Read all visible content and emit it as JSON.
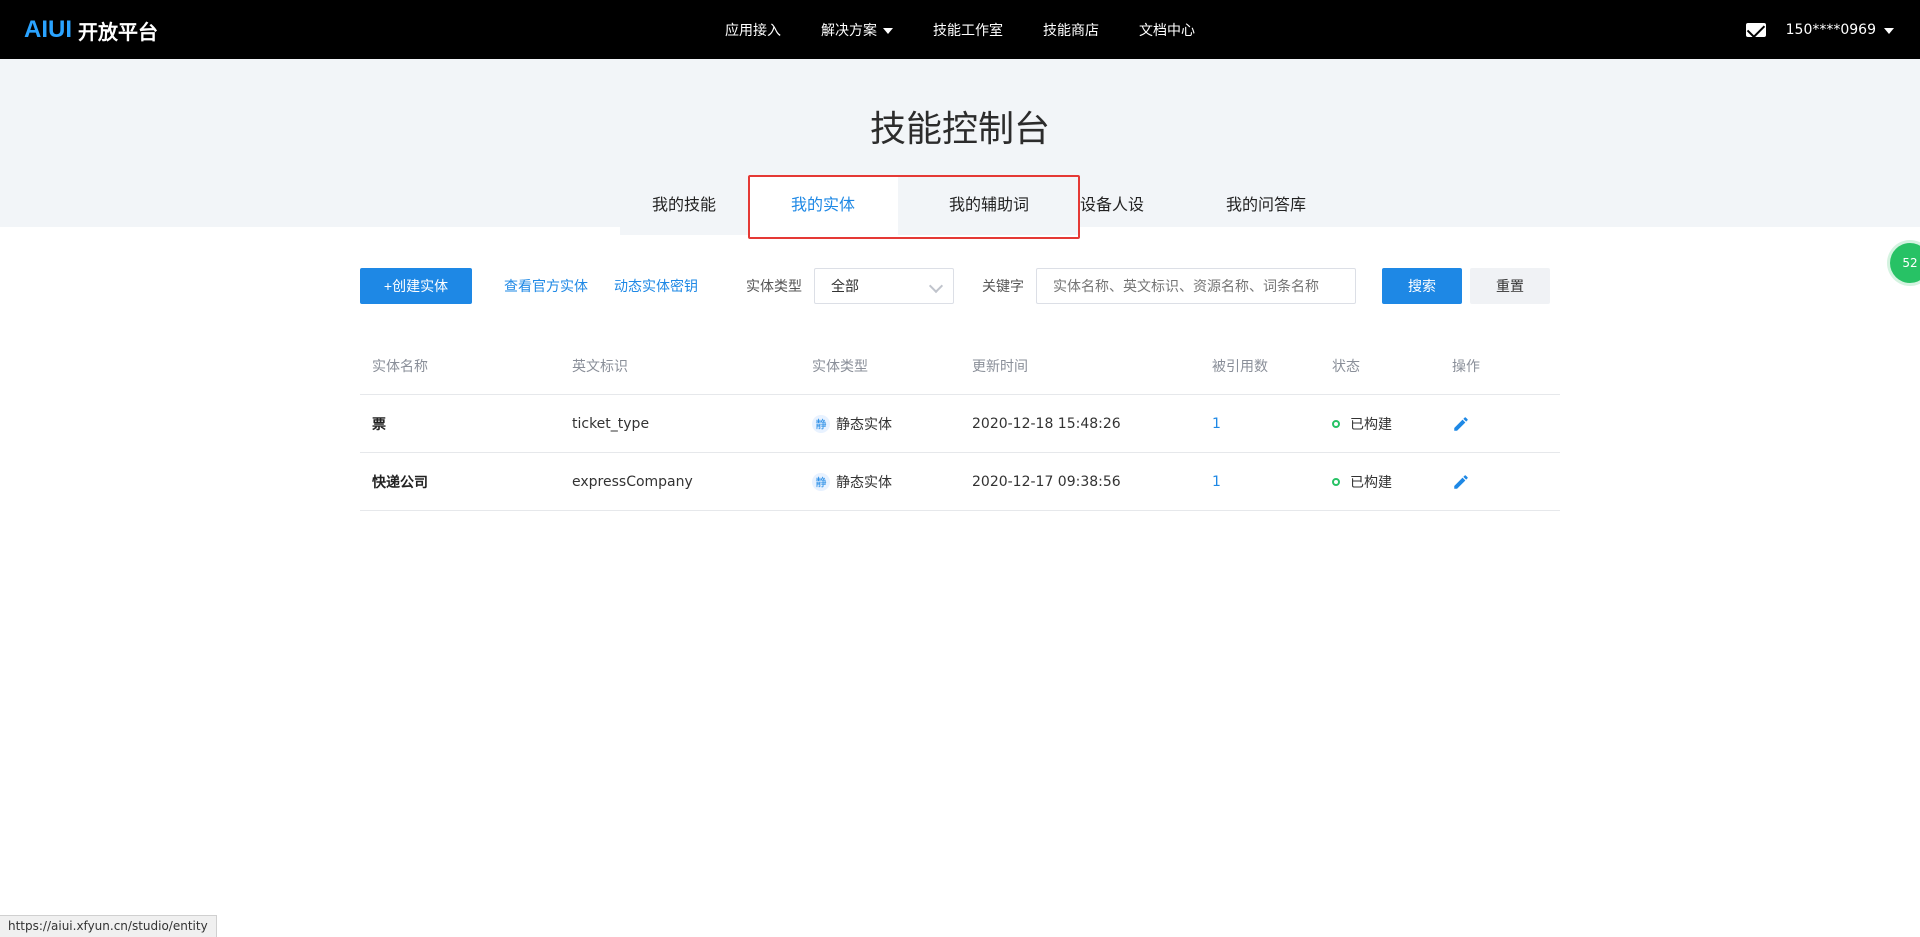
{
  "app": {
    "logo_brand": "AIUI",
    "logo_rest": "开放平台"
  },
  "nav": {
    "items": [
      {
        "label": "应用接入"
      },
      {
        "label": "解决方案",
        "has_caret": true
      },
      {
        "label": "技能工作室"
      },
      {
        "label": "技能商店"
      },
      {
        "label": "文档中心"
      }
    ]
  },
  "user": {
    "masked_phone": "150****0969"
  },
  "hero": {
    "title": "技能控制台"
  },
  "tabs": [
    {
      "label": "我的技能"
    },
    {
      "label": "我的实体"
    },
    {
      "label": "我的辅助词"
    },
    {
      "label": "设备人设"
    },
    {
      "label": "我的问答库"
    }
  ],
  "toolbar": {
    "create_label": "+创建实体",
    "link_official": "查看官方实体",
    "link_dynamic": "动态实体密钥",
    "type_label": "实体类型",
    "type_selected": "全部",
    "keyword_label": "关键字",
    "keyword_placeholder": "实体名称、英文标识、资源名称、词条名称",
    "search_label": "搜索",
    "reset_label": "重置"
  },
  "table": {
    "headers": [
      "实体名称",
      "英文标识",
      "实体类型",
      "更新时间",
      "被引用数",
      "状态",
      "操作"
    ],
    "rows": [
      {
        "name": "票",
        "id": "ticket_type",
        "type_badge": "静",
        "type_text": "静态实体",
        "updated": "2020-12-18 15:48:26",
        "refs": "1",
        "status": "已构建"
      },
      {
        "name": "快递公司",
        "id": "expressCompany",
        "type_badge": "静",
        "type_text": "静态实体",
        "updated": "2020-12-17 09:38:56",
        "refs": "1",
        "status": "已构建"
      }
    ]
  },
  "floating": {
    "bubble_text": "52"
  },
  "status_url": "https://aiui.xfyun.cn/studio/entity",
  "colors": {
    "primary": "#1e88e5",
    "success": "#27c265",
    "highlight": "#e53935"
  }
}
